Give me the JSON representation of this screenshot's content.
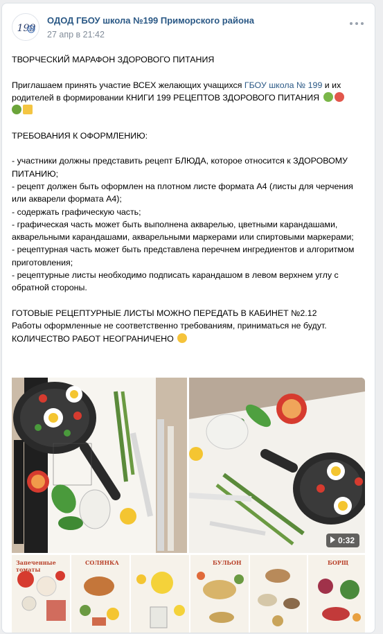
{
  "post": {
    "author": "ОДОД ГБОУ школа №199 Приморского района",
    "date": "27 апр в 21:42",
    "avatar_text": "199"
  },
  "text": {
    "title": "ТВОРЧЕСКИЙ МАРАФОН ЗДОРОВОГО ПИТАНИЯ",
    "invite_before": "Приглашаем принять участие ВСЕХ желающих учащихся ",
    "invite_link": "ГБОУ школа № 199",
    "invite_after": " и их родителей в формировании КНИГИ 199 РЕЦЕПТОВ ЗДОРОВОГО ПИТАНИЯ",
    "requirements_title": "ТРЕБОВАНИЯ К ОФОРМЛЕНИЮ:",
    "requirements": [
      "- участники должны представить рецепт БЛЮДА, которое относится к ЗДОРОВОМУ ПИТАНИЮ;",
      "- рецепт должен быть оформлен на плотном листе формата А4 (листы для черчения или акварели формата А4);",
      "- содержать графическую часть;",
      "- графическая часть может быть выполнена акварелью, цветными карандашами, акварельными карандашами, акварельными маркерами или спиртовыми маркерами;",
      "- рецептурная часть может быть представлена перечнем ингредиентов и алгоритмом приготовления;",
      "- рецептурные листы необходимо подписать карандашом в левом верхнем углу с обратной стороны."
    ],
    "closing": [
      "ГОТОВЫЕ РЕЦЕПТУРНЫЕ ЛИСТЫ МОЖНО ПЕРЕДАТЬ В КАБИНЕТ №2.12",
      "Работы оформленные не соответственно требованиям, приниматься не будут.",
      "КОЛИЧЕСТВО РАБОТ НЕОГРАНИЧЕНО"
    ]
  },
  "media": {
    "video_duration": "0:32",
    "thumb_labels": [
      "Запеченные томаты",
      "СОЛЯНКА",
      "",
      "БУЛЬОН",
      "",
      "БОРЩ"
    ]
  },
  "colors": {
    "link": "#2a5885",
    "date": "#818c99",
    "background": "#edeef0"
  }
}
